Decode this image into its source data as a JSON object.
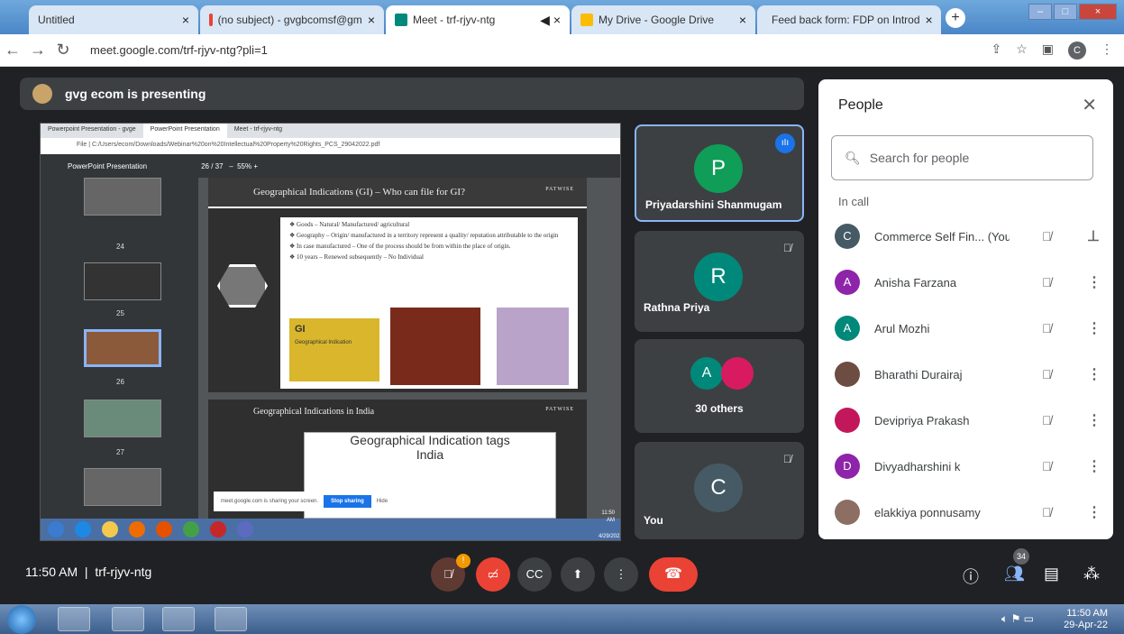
{
  "browser": {
    "tabs": [
      {
        "label": "Untitled",
        "active": false
      },
      {
        "label": "(no subject) - gvgbcomsf@gm",
        "active": false
      },
      {
        "label": "Meet - trf-rjyv-ntg",
        "active": true
      },
      {
        "label": "My Drive - Google Drive",
        "active": false
      },
      {
        "label": "Feed back form: FDP on Introd",
        "active": false
      }
    ],
    "url": "meet.google.com/trf-rjyv-ntg?pli=1"
  },
  "presenting_banner": "gvg ecom is presenting",
  "shared_screen": {
    "tabs": [
      "Powerpoint Presentation - gvge",
      "PowerPoint Presentation",
      "Meet - trf-rjyv-ntg"
    ],
    "url": "File | C:/Users/ecom/Downloads/Webinar%20on%20Intellectual%20Property%20Rights_PCS_29042022.pdf",
    "doc_title": "PowerPoint Presentation",
    "page": "26",
    "page_total": "/ 37",
    "zoom": "55%",
    "thumb_numbers": [
      "24",
      "25",
      "26",
      "27"
    ],
    "slide1_title": "Geographical Indications (GI) – Who can file for GI?",
    "slide1_brand": "PATWISE",
    "slide1_bullets": [
      "❖ Goods – Natural/ Manufactured/ agricultural",
      "❖ Geography – Origin/ manufactured in a territory represent a quality/ reputation attributable to the origin",
      "❖ In case manufactured – One of the process should be from within the place of origin.",
      "❖ 10 years – Renewed subsequently – No Individual"
    ],
    "gi_logo_text": "GI",
    "gi_logo_caption": "Geographical Indication",
    "slide2_title": "Geographical Indications in India",
    "slide2_brand": "PATWISE",
    "slide2_box_line1": "Geographical Indication tags",
    "slide2_box_line2": "India",
    "sharing_text": "meet.google.com is sharing your screen.",
    "stop_sharing": "Stop sharing",
    "hide": "Hide",
    "taskbar_time": "11:50 AM",
    "taskbar_date": "4/29/2022"
  },
  "tiles": [
    {
      "initial": "P",
      "name": "Priyadarshini Shanmugam",
      "color": "#0f9d58"
    },
    {
      "initial": "R",
      "name": "Rathna Priya",
      "color": "#00897b"
    },
    {
      "initial": "A",
      "name": "30 others",
      "color": "#00897b"
    },
    {
      "initial": "C",
      "name": "You",
      "color": "#455a64"
    }
  ],
  "people": {
    "title": "People",
    "search_placeholder": "Search for people",
    "section": "In call",
    "list": [
      {
        "initial": "C",
        "name": "Commerce Self Fin...",
        "suffix": "(You)",
        "color": "#455a64"
      },
      {
        "initial": "A",
        "name": "Anisha Farzana",
        "suffix": "",
        "color": "#8e24aa"
      },
      {
        "initial": "A",
        "name": "Arul Mozhi",
        "suffix": "",
        "color": "#00897b"
      },
      {
        "initial": "",
        "name": "Bharathi Durairaj",
        "suffix": "",
        "color": "#6d4c41"
      },
      {
        "initial": "",
        "name": "Devipriya Prakash",
        "suffix": "",
        "color": "#c2185b"
      },
      {
        "initial": "D",
        "name": "Divyadharshini k",
        "suffix": "",
        "color": "#8e24aa"
      },
      {
        "initial": "",
        "name": "elakkiya ponnusamy",
        "suffix": "",
        "color": "#8d6e63"
      }
    ]
  },
  "bottom_bar": {
    "time": "11:50 AM",
    "separator": "|",
    "meeting_code": "trf-rjyv-ntg",
    "participant_count": "34",
    "alert": "!"
  },
  "os_taskbar": {
    "time": "11:50 AM",
    "date": "29-Apr-22"
  }
}
